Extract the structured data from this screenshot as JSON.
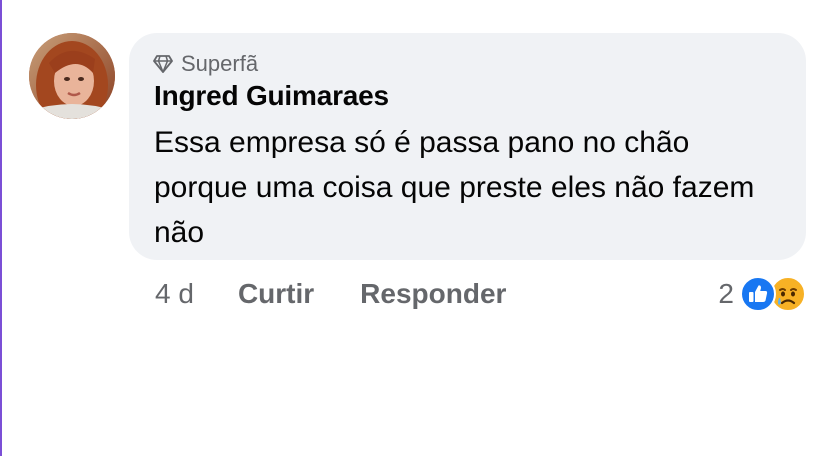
{
  "comment": {
    "badge": {
      "icon": "diamond-icon",
      "label": "Superfã"
    },
    "author": "Ingred Guimaraes",
    "text": "Essa empresa só é passa pano no chão porque uma coisa que preste eles não fazem não",
    "time": "4 d",
    "actions": {
      "like": "Curtir",
      "reply": "Responder"
    },
    "reactions": {
      "count": "2",
      "types": [
        "like-icon",
        "sad-icon"
      ]
    }
  },
  "colors": {
    "bubble": "#f0f2f5",
    "meta_text": "#65676b",
    "primary_text": "#050505",
    "like_blue": "#1877f2",
    "sad_yellow": "#f7b125"
  }
}
